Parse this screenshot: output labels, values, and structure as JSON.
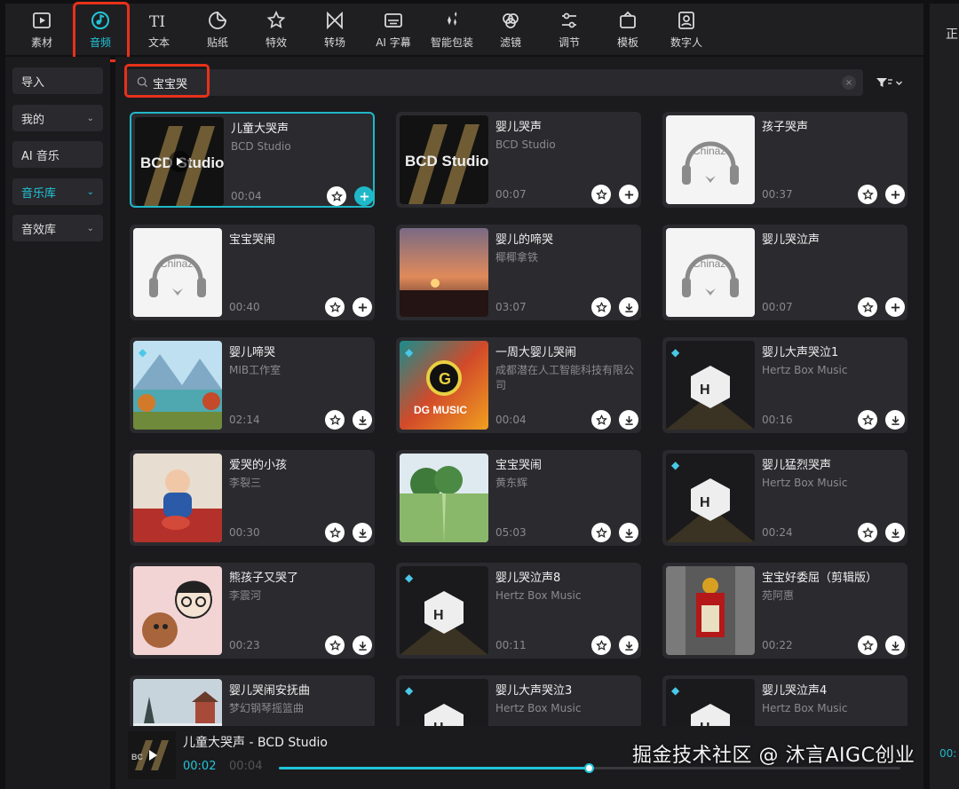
{
  "toolbar": {
    "tools": [
      {
        "label": "素材",
        "icon": "media-icon"
      },
      {
        "label": "音频",
        "icon": "audio-icon",
        "active": true
      },
      {
        "label": "文本",
        "icon": "text-icon"
      },
      {
        "label": "贴纸",
        "icon": "sticker-icon"
      },
      {
        "label": "特效",
        "icon": "effects-icon"
      },
      {
        "label": "转场",
        "icon": "transition-icon"
      },
      {
        "label": "AI 字幕",
        "icon": "subtitle-icon"
      },
      {
        "label": "智能包装",
        "icon": "smart-pack-icon"
      },
      {
        "label": "滤镜",
        "icon": "filter-icon"
      },
      {
        "label": "调节",
        "icon": "adjust-icon"
      },
      {
        "label": "模板",
        "icon": "template-icon"
      },
      {
        "label": "数字人",
        "icon": "digital-human-icon"
      }
    ]
  },
  "right_panel": {
    "label": "正"
  },
  "sidebar": {
    "items": [
      {
        "label": "导入",
        "chevron": ""
      },
      {
        "label": "我的",
        "chevron": "⌄"
      },
      {
        "label": "AI 音乐",
        "chevron": ""
      },
      {
        "label": "音乐库",
        "chevron": "⌄",
        "active": true
      },
      {
        "label": "音效库",
        "chevron": "⌄"
      }
    ]
  },
  "search": {
    "value": "宝宝哭",
    "clear": "×"
  },
  "accent_color": "#21c5d8",
  "highlight_color": "#e8311a",
  "results": [
    {
      "title": "儿童大哭声",
      "artist": "BCD Studio",
      "duration": "00:04",
      "thumb": "BCD Studio",
      "thumb_kind": "bcd",
      "action": "add",
      "selected": true
    },
    {
      "title": "婴儿哭声",
      "artist": "BCD Studio",
      "duration": "00:07",
      "thumb": "BCD Studio",
      "thumb_kind": "bcd",
      "action": "add"
    },
    {
      "title": "孩子哭声",
      "artist": "",
      "duration": "00:37",
      "thumb": "Chinaz",
      "thumb_kind": "chinaz",
      "action": "add"
    },
    {
      "title": "宝宝哭闹",
      "artist": "",
      "duration": "00:40",
      "thumb": "Chinaz",
      "thumb_kind": "chinaz",
      "action": "add"
    },
    {
      "title": "婴儿的啼哭",
      "artist": "椰椰拿铁",
      "duration": "03:07",
      "thumb_kind": "sunset",
      "action": "download"
    },
    {
      "title": "婴儿哭泣声",
      "artist": "",
      "duration": "00:07",
      "thumb": "Chinaz",
      "thumb_kind": "chinaz",
      "action": "add"
    },
    {
      "title": "婴儿啼哭",
      "artist": "MIB工作室",
      "duration": "02:14",
      "thumb_kind": "lake",
      "action": "download",
      "vip": true
    },
    {
      "title": "一周大婴儿哭闹",
      "artist": "成都潜在人工智能科技有限公司",
      "duration": "00:04",
      "thumb": "DG MUSIC",
      "thumb_kind": "dg",
      "action": "download",
      "vip": true
    },
    {
      "title": "婴儿大声哭泣1",
      "artist": "Hertz Box Music",
      "duration": "00:16",
      "thumb_kind": "hertz",
      "action": "download",
      "vip": true
    },
    {
      "title": "爱哭的小孩",
      "artist": "李裂三",
      "duration": "00:30",
      "thumb_kind": "kid",
      "action": "download"
    },
    {
      "title": "宝宝哭闹",
      "artist": "黄东辉",
      "duration": "05:03",
      "thumb_kind": "field",
      "action": "download"
    },
    {
      "title": "婴儿猛烈哭声",
      "artist": "Hertz Box Music",
      "duration": "00:24",
      "thumb_kind": "hertz",
      "action": "download",
      "vip": true
    },
    {
      "title": "熊孩子又哭了",
      "artist": "李震河",
      "duration": "00:23",
      "thumb_kind": "cartoon",
      "action": "download"
    },
    {
      "title": "婴儿哭泣声8",
      "artist": "Hertz Box Music",
      "duration": "00:11",
      "thumb_kind": "hertz",
      "action": "download",
      "vip": true
    },
    {
      "title": "宝宝好委屈（剪辑版）",
      "artist": "苑阿惠",
      "duration": "00:22",
      "thumb_kind": "opera",
      "action": "download"
    },
    {
      "title": "婴儿哭闹安抚曲",
      "artist": "梦幻钢琴摇篮曲",
      "duration": "",
      "thumb_kind": "winter",
      "action": "none"
    },
    {
      "title": "婴儿大声哭泣3",
      "artist": "Hertz Box Music",
      "duration": "",
      "thumb_kind": "hertz",
      "action": "none",
      "vip": true
    },
    {
      "title": "婴儿哭泣声4",
      "artist": "Hertz Box Music",
      "duration": "",
      "thumb_kind": "hertz",
      "action": "none",
      "vip": true
    }
  ],
  "player": {
    "title": "儿童大哭声 - BCD Studio",
    "current": "00:02",
    "total": "00:04",
    "progress": 0.5
  },
  "watermark": {
    "text": "掘金技术社区 @ 沐言AIGC创业",
    "tail": "00:"
  }
}
